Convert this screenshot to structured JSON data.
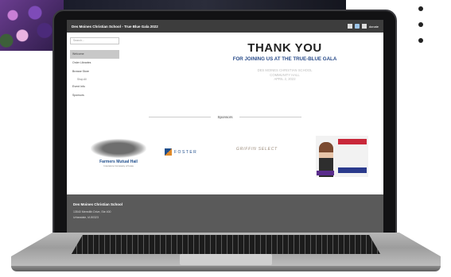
{
  "browser_window": {
    "site_title": "Des Moines Christian School - True Blue Gala 2022",
    "header_link": "donate"
  },
  "sidebar": {
    "search_placeholder": "Search...",
    "items": [
      {
        "label": "Welcome"
      },
      {
        "label": "Order Libraries"
      },
      {
        "label": "Browse Store"
      },
      {
        "label": "Shop All"
      },
      {
        "label": "Event Info"
      },
      {
        "label": "Sponsors"
      }
    ]
  },
  "main": {
    "heading": "THANK YOU",
    "subheading": "FOR JOINING US AT THE TRUE-BLUE GALA",
    "detail_lines": [
      "DES MOINES CHRISTIAN SCHOOL",
      "COMMUNITY HALL",
      "APRIL 2, 2022"
    ],
    "sponsors_label": "Sponsors"
  },
  "sponsor_logos": {
    "farmers": {
      "name": "Farmers Mutual Hail",
      "subtitle": "Insurance Company of Iowa"
    },
    "foster": {
      "name": "FOSTER"
    },
    "griffin": {
      "name": "GRIFFIN SELECT"
    }
  },
  "footer": {
    "title": "Des Moines Christian School",
    "address_line1": "13540 Meredith Drive, Ste 400",
    "address_line2": "Urbandale, IA 50323"
  }
}
